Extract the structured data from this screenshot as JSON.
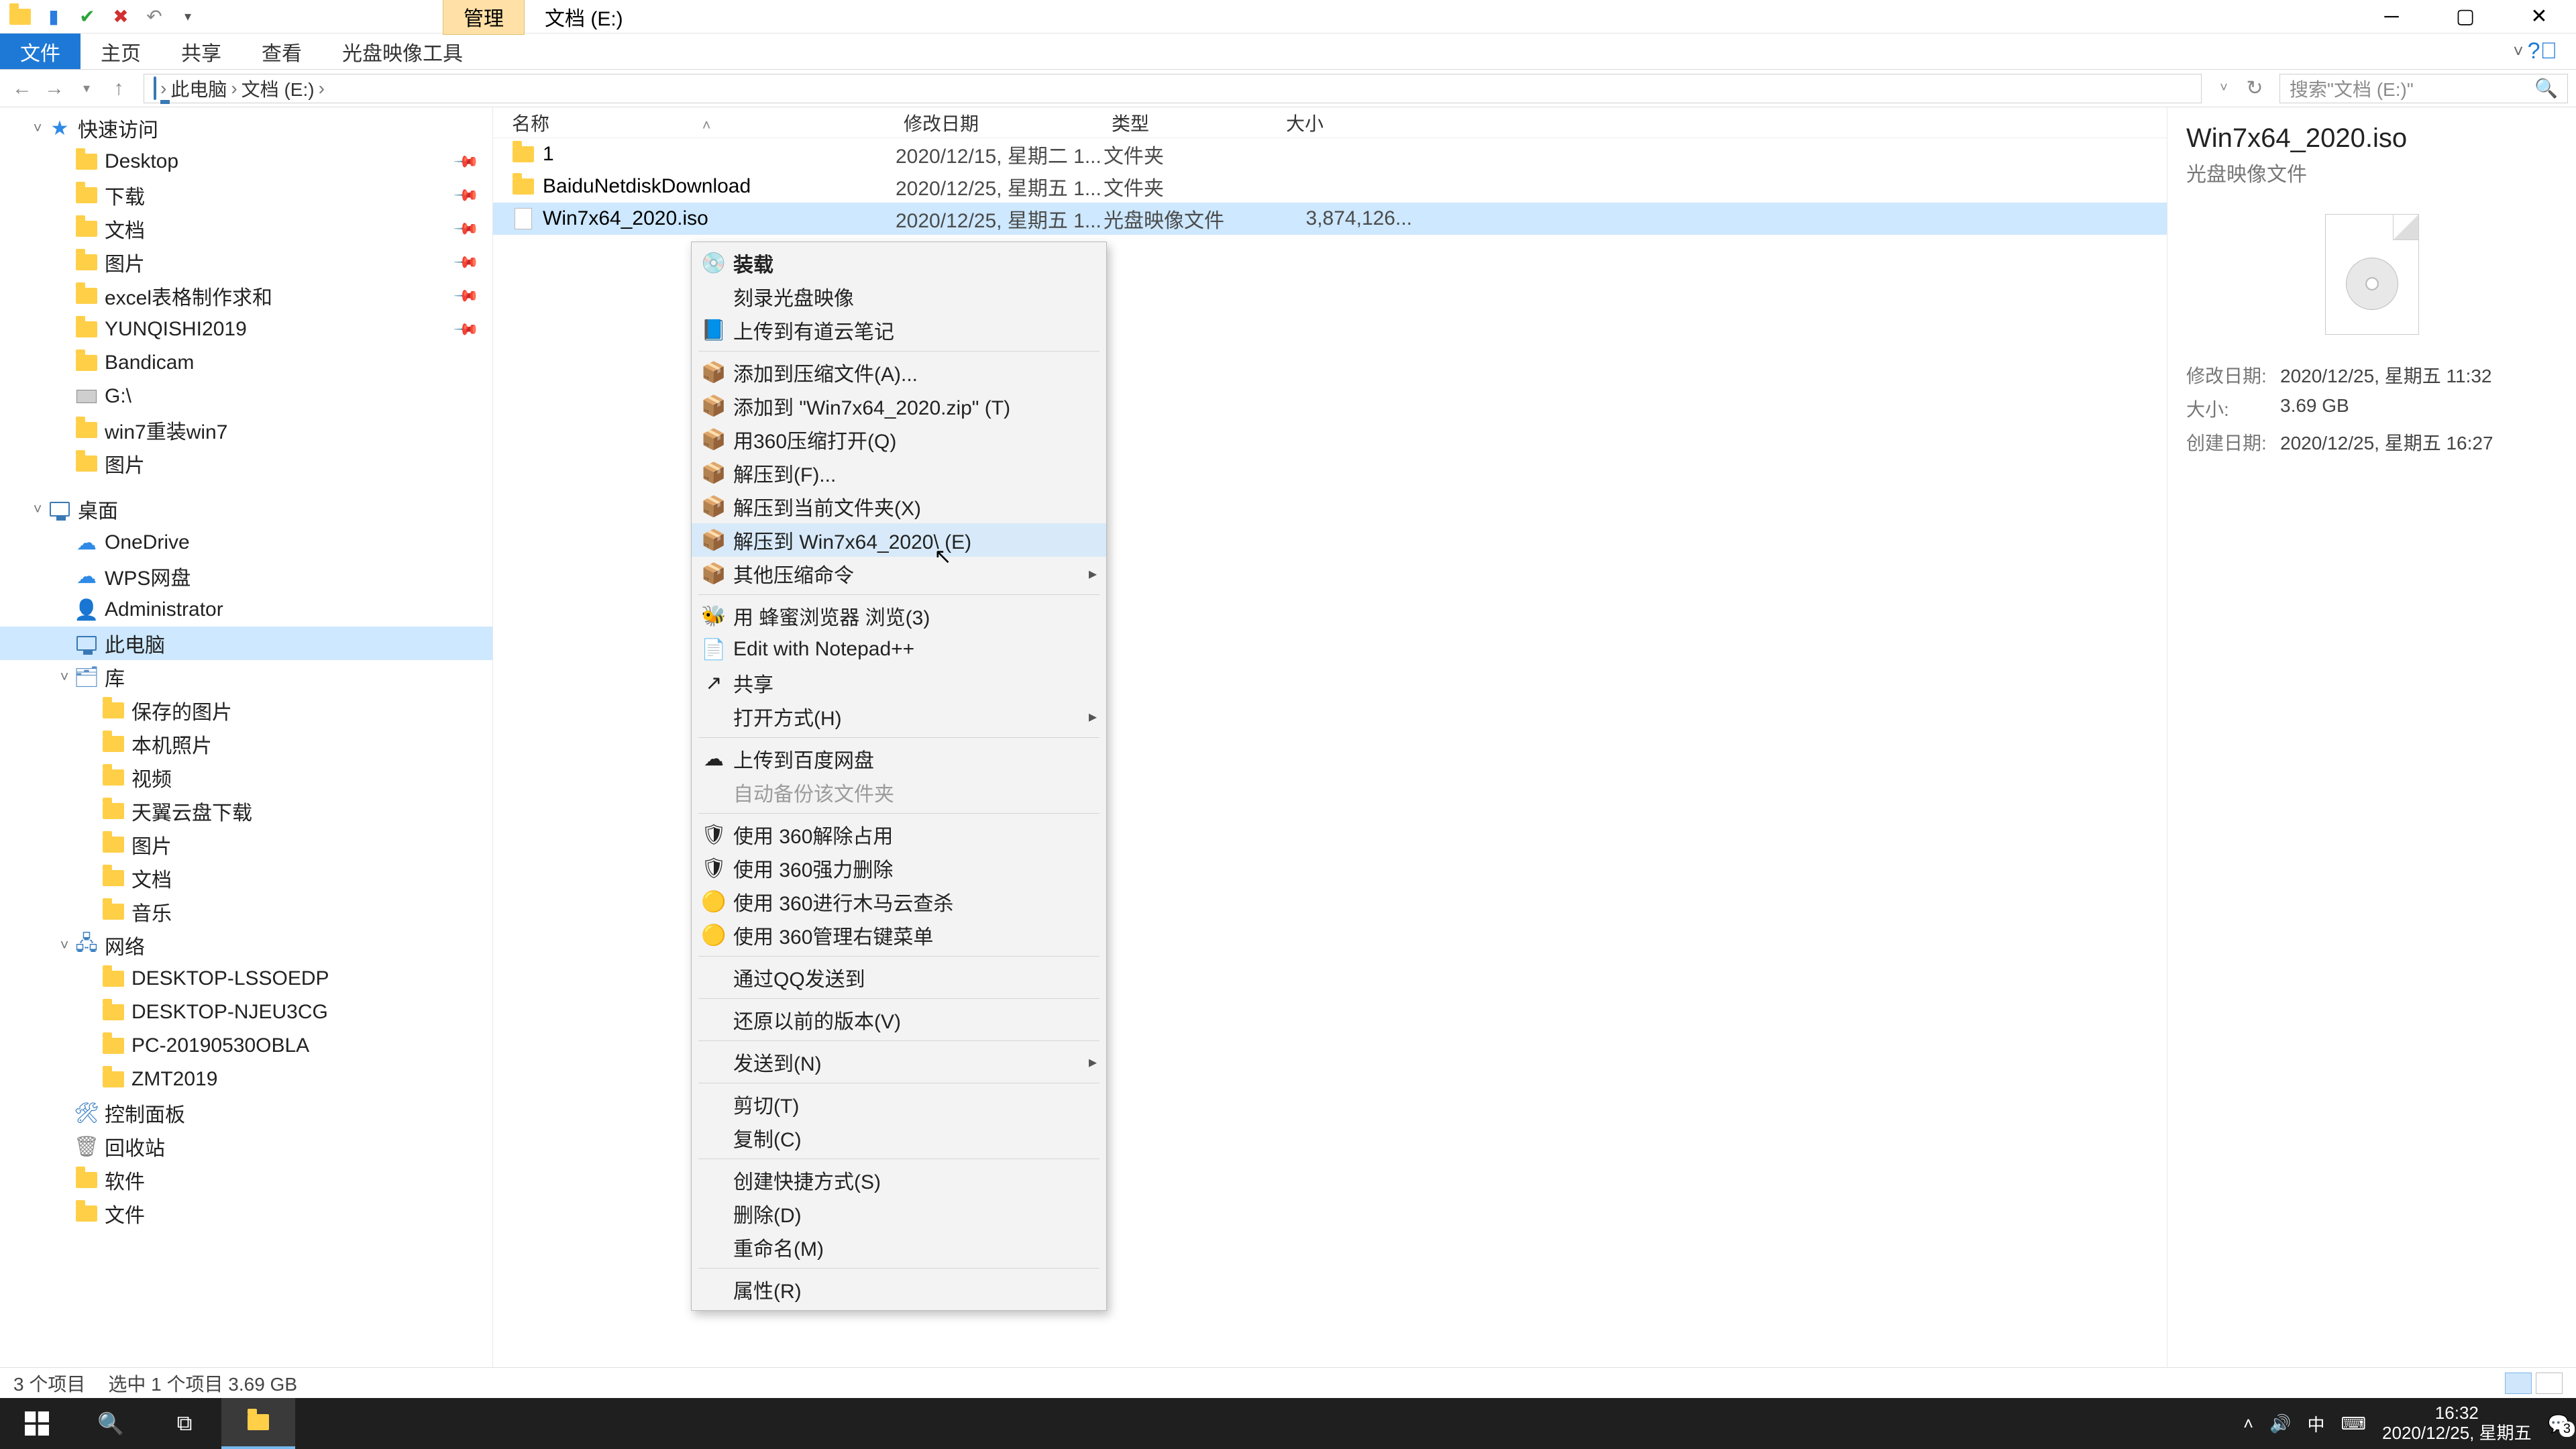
{
  "window": {
    "context_tab": "管理",
    "title": "文档 (E:)"
  },
  "ribbon": {
    "file": "文件",
    "tabs": [
      "主页",
      "共享",
      "查看",
      "光盘映像工具"
    ]
  },
  "nav": {
    "crumbs": [
      "此电脑",
      "文档 (E:)"
    ],
    "search_placeholder": "搜索\"文档 (E:)\""
  },
  "tree": {
    "quick": {
      "label": "快速访问",
      "items": [
        {
          "label": "Desktop",
          "pin": true,
          "ico": "folder"
        },
        {
          "label": "下载",
          "pin": true,
          "ico": "folder"
        },
        {
          "label": "文档",
          "pin": true,
          "ico": "folder"
        },
        {
          "label": "图片",
          "pin": true,
          "ico": "folder"
        },
        {
          "label": "excel表格制作求和",
          "pin": true,
          "ico": "folder"
        },
        {
          "label": "YUNQISHI2019",
          "pin": true,
          "ico": "folder"
        },
        {
          "label": "Bandicam",
          "pin": false,
          "ico": "folder"
        },
        {
          "label": "G:\\",
          "pin": false,
          "ico": "disk"
        },
        {
          "label": "win7重装win7",
          "pin": false,
          "ico": "folder"
        },
        {
          "label": "图片",
          "pin": false,
          "ico": "folder"
        }
      ]
    },
    "desktop": {
      "label": "桌面",
      "items": [
        {
          "label": "OneDrive",
          "ico": "cloud"
        },
        {
          "label": "WPS网盘",
          "ico": "cloud"
        },
        {
          "label": "Administrator",
          "ico": "user"
        },
        {
          "label": "此电脑",
          "ico": "monitor",
          "selected": true
        },
        {
          "label": "库",
          "ico": "lib",
          "expand": true,
          "children": [
            {
              "label": "保存的图片"
            },
            {
              "label": "本机照片"
            },
            {
              "label": "视频"
            },
            {
              "label": "天翼云盘下载"
            },
            {
              "label": "图片"
            },
            {
              "label": "文档"
            },
            {
              "label": "音乐"
            }
          ]
        },
        {
          "label": "网络",
          "ico": "net",
          "expand": true,
          "children": [
            {
              "label": "DESKTOP-LSSOEDP"
            },
            {
              "label": "DESKTOP-NJEU3CG"
            },
            {
              "label": "PC-20190530OBLA"
            },
            {
              "label": "ZMT2019"
            }
          ]
        },
        {
          "label": "控制面板",
          "ico": "cpanel"
        },
        {
          "label": "回收站",
          "ico": "bin"
        },
        {
          "label": "软件",
          "ico": "folder"
        },
        {
          "label": "文件",
          "ico": "folder"
        }
      ]
    }
  },
  "columns": {
    "name": "名称",
    "date": "修改日期",
    "type": "类型",
    "size": "大小"
  },
  "rows": [
    {
      "name": "1",
      "date": "2020/12/15, 星期二 1...",
      "type": "文件夹",
      "size": "",
      "ico": "folder"
    },
    {
      "name": "BaiduNetdiskDownload",
      "date": "2020/12/25, 星期五 1...",
      "type": "文件夹",
      "size": "",
      "ico": "folder"
    },
    {
      "name": "Win7x64_2020.iso",
      "date": "2020/12/25, 星期五 1...",
      "type": "光盘映像文件",
      "size": "3,874,126...",
      "ico": "file",
      "selected": true
    }
  ],
  "context": [
    {
      "t": "装载",
      "bold": true,
      "ico": "disc"
    },
    {
      "t": "刻录光盘映像"
    },
    {
      "t": "上传到有道云笔记",
      "ico": "note"
    },
    {
      "sep": true
    },
    {
      "t": "添加到压缩文件(A)...",
      "ico": "zip"
    },
    {
      "t": "添加到 \"Win7x64_2020.zip\" (T)",
      "ico": "zip"
    },
    {
      "t": "用360压缩打开(Q)",
      "ico": "zip"
    },
    {
      "t": "解压到(F)...",
      "ico": "zip"
    },
    {
      "t": "解压到当前文件夹(X)",
      "ico": "zip"
    },
    {
      "t": "解压到 Win7x64_2020\\ (E)",
      "ico": "zip",
      "hl": true
    },
    {
      "t": "其他压缩命令",
      "ico": "zip",
      "sub": true
    },
    {
      "sep": true
    },
    {
      "t": "用 蜂蜜浏览器 浏览(3)",
      "ico": "bee"
    },
    {
      "t": "Edit with Notepad++",
      "ico": "npp"
    },
    {
      "t": "共享",
      "ico": "share"
    },
    {
      "t": "打开方式(H)",
      "sub": true
    },
    {
      "sep": true
    },
    {
      "t": "上传到百度网盘",
      "ico": "baidu"
    },
    {
      "t": "自动备份该文件夹",
      "dis": true
    },
    {
      "sep": true
    },
    {
      "t": "使用 360解除占用",
      "ico": "360"
    },
    {
      "t": "使用 360强力删除",
      "ico": "360"
    },
    {
      "t": "使用 360进行木马云查杀",
      "ico": "360y"
    },
    {
      "t": "使用 360管理右键菜单",
      "ico": "360y"
    },
    {
      "sep": true
    },
    {
      "t": "通过QQ发送到"
    },
    {
      "sep": true
    },
    {
      "t": "还原以前的版本(V)"
    },
    {
      "sep": true
    },
    {
      "t": "发送到(N)",
      "sub": true
    },
    {
      "sep": true
    },
    {
      "t": "剪切(T)"
    },
    {
      "t": "复制(C)"
    },
    {
      "sep": true
    },
    {
      "t": "创建快捷方式(S)"
    },
    {
      "t": "删除(D)"
    },
    {
      "t": "重命名(M)"
    },
    {
      "sep": true
    },
    {
      "t": "属性(R)"
    }
  ],
  "preview": {
    "name": "Win7x64_2020.iso",
    "type": "光盘映像文件",
    "meta": [
      {
        "k": "修改日期:",
        "v": "2020/12/25, 星期五 11:32"
      },
      {
        "k": "大小:",
        "v": "3.69 GB"
      },
      {
        "k": "创建日期:",
        "v": "2020/12/25, 星期五 16:27"
      }
    ]
  },
  "status": {
    "total": "3 个项目",
    "sel": "选中 1 个项目  3.69 GB"
  },
  "tray": {
    "ime": "中",
    "time": "16:32",
    "date": "2020/12/25, 星期五",
    "badge": "3"
  }
}
